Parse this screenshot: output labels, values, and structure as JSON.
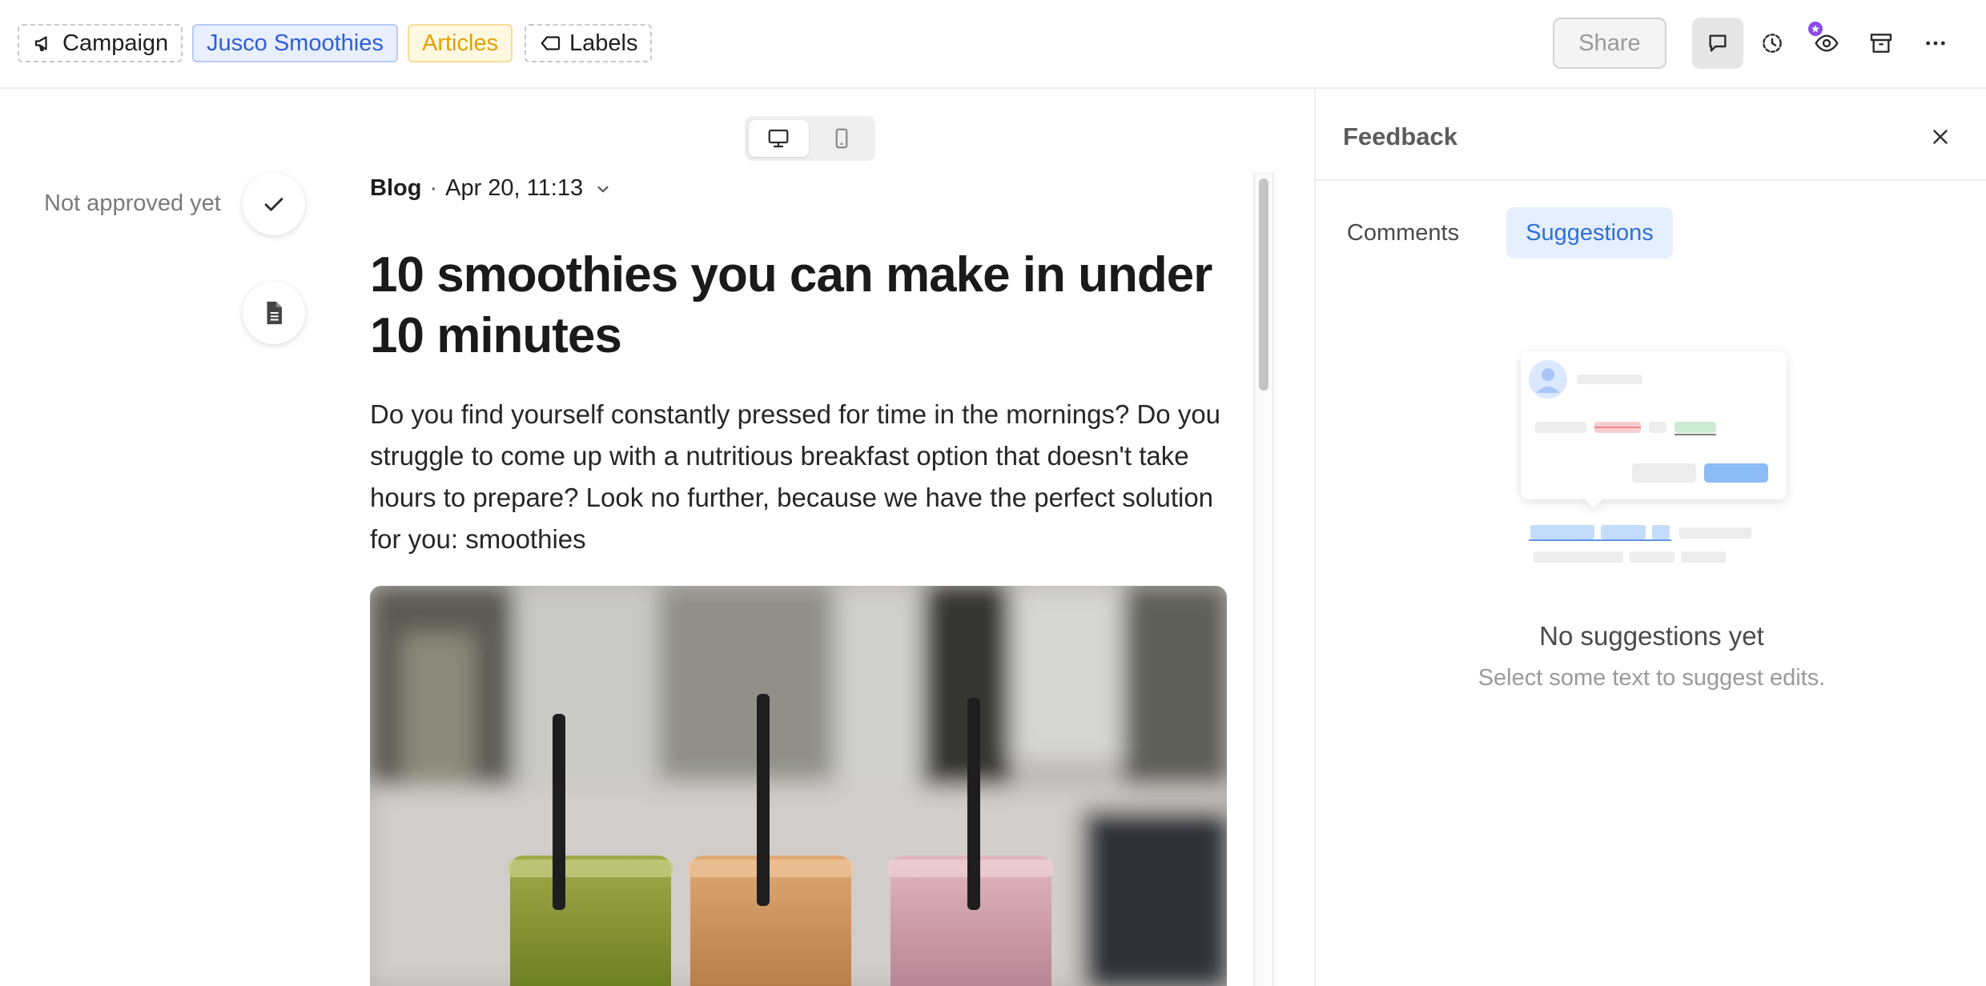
{
  "topbar": {
    "chips": {
      "campaign": "Campaign",
      "brand": "Jusco Smoothies",
      "type": "Articles",
      "labels": "Labels"
    },
    "share_label": "Share",
    "tools": [
      "comment-icon",
      "history-icon",
      "preview-icon",
      "archive-icon",
      "more-icon"
    ]
  },
  "approval": {
    "status_text": "Not approved yet"
  },
  "device_switch": {
    "options": [
      "desktop",
      "mobile"
    ],
    "selected": "desktop"
  },
  "article": {
    "category": "Blog",
    "separator": "·",
    "date": "Apr 20, 11:13",
    "title": "10 smoothies you can make in under 10 minutes",
    "body": "Do you find yourself constantly pressed for time in the mornings? Do you struggle to come up with a nutritious breakfast option that doesn't take hours to prepare? Look no further, because we have the perfect solution for you: smoothies"
  },
  "feedback": {
    "title": "Feedback",
    "tabs": [
      "Comments",
      "Suggestions"
    ],
    "active_tab": "Suggestions",
    "empty_title": "No suggestions yet",
    "empty_subtitle": "Select some text to suggest edits."
  },
  "colors": {
    "accent_blue": "#2f6fd6",
    "articles_yellow": "#e3a008",
    "brand_chip_blue": "#2f5fd6",
    "badge_purple": "#8a4be8"
  }
}
